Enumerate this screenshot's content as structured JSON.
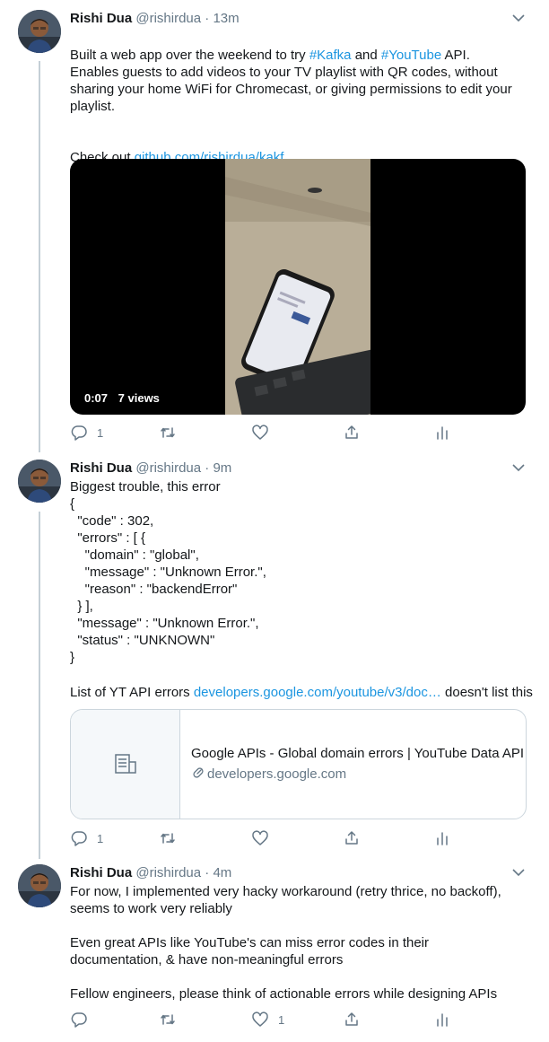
{
  "tweets": [
    {
      "name": "Rishi Dua",
      "handle": "@rishirdua",
      "separator": "·",
      "time": "13m",
      "text_intro": "Built a web app over the weekend to try ",
      "hashtag1": "#Kafka",
      "text_and": " and ",
      "hashtag2": "#YouTube",
      "text_api": " API.",
      "paragraph2": "Enables guests to add videos to your TV playlist with QR codes, without sharing your home WiFi for Chromecast, or giving permissions to edit your playlist.",
      "checkout_prefix": "Check out ",
      "checkout_link": "github.com/rishirdua/kakf…",
      "video": {
        "duration": "0:07",
        "views": "7 views"
      },
      "actions": {
        "reply_count": "1",
        "retweet_count": "",
        "like_count": ""
      }
    },
    {
      "name": "Rishi Dua",
      "handle": "@rishirdua",
      "separator": "·",
      "time": "9m",
      "text": "Biggest trouble, this error\n{\n  \"code\" : 302,\n  \"errors\" : [ {\n    \"domain\" : \"global\",\n    \"message\" : \"Unknown Error.\",\n    \"reason\" : \"backendError\"\n  } ],\n  \"message\" : \"Unknown Error.\",\n  \"status\" : \"UNKNOWN\"\n}",
      "list_prefix": "List of YT API errors ",
      "list_link": "developers.google.com/youtube/v3/doc…",
      "list_suffix": " doesn't list this",
      "card": {
        "title": "Google APIs - Global domain errors  |  YouTube Data API",
        "url": "developers.google.com"
      },
      "actions": {
        "reply_count": "1",
        "retweet_count": "",
        "like_count": ""
      }
    },
    {
      "name": "Rishi Dua",
      "handle": "@rishirdua",
      "separator": "·",
      "time": "4m",
      "paragraph1": "For now, I implemented very hacky workaround (retry thrice, no backoff), seems to work very reliably",
      "paragraph2": "Even great APIs like YouTube's can miss error codes in their documentation, & have non-meaningful errors",
      "paragraph3": "Fellow engineers, please think of actionable errors while designing APIs",
      "actions": {
        "reply_count": "",
        "retweet_count": "",
        "like_count": "1"
      }
    }
  ],
  "icons": [
    "chevron-down-icon",
    "reply-icon",
    "retweet-icon",
    "like-icon",
    "share-icon",
    "analytics-icon",
    "document-icon",
    "link-icon"
  ],
  "colors": {
    "link": "#1b95e0",
    "secondary": "#657786",
    "border": "#ccd6dd",
    "thread": "#c4cfd6"
  }
}
